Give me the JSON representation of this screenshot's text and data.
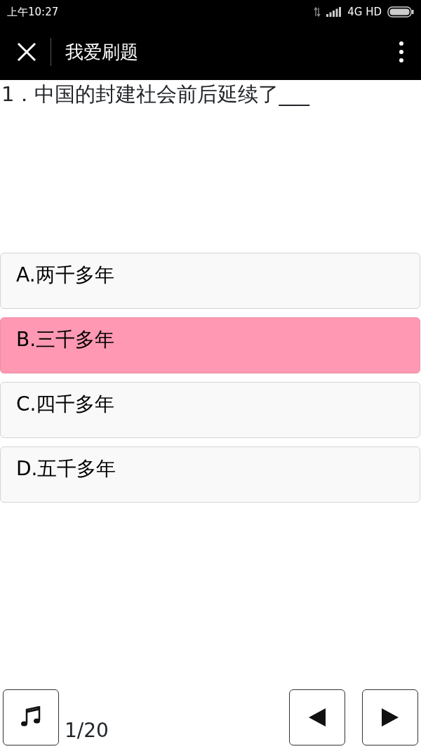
{
  "status_bar": {
    "time": "上午10:27",
    "network": "4G HD"
  },
  "title_bar": {
    "title": "我爱刷题"
  },
  "question": {
    "text": "1．中国的封建社会前后延续了___"
  },
  "options": [
    {
      "label": "A.两千多年",
      "selected": false
    },
    {
      "label": "B.三千多年",
      "selected": true
    },
    {
      "label": "C.四千多年",
      "selected": false
    },
    {
      "label": "D.五千多年",
      "selected": false
    }
  ],
  "footer": {
    "progress": "1/20"
  }
}
